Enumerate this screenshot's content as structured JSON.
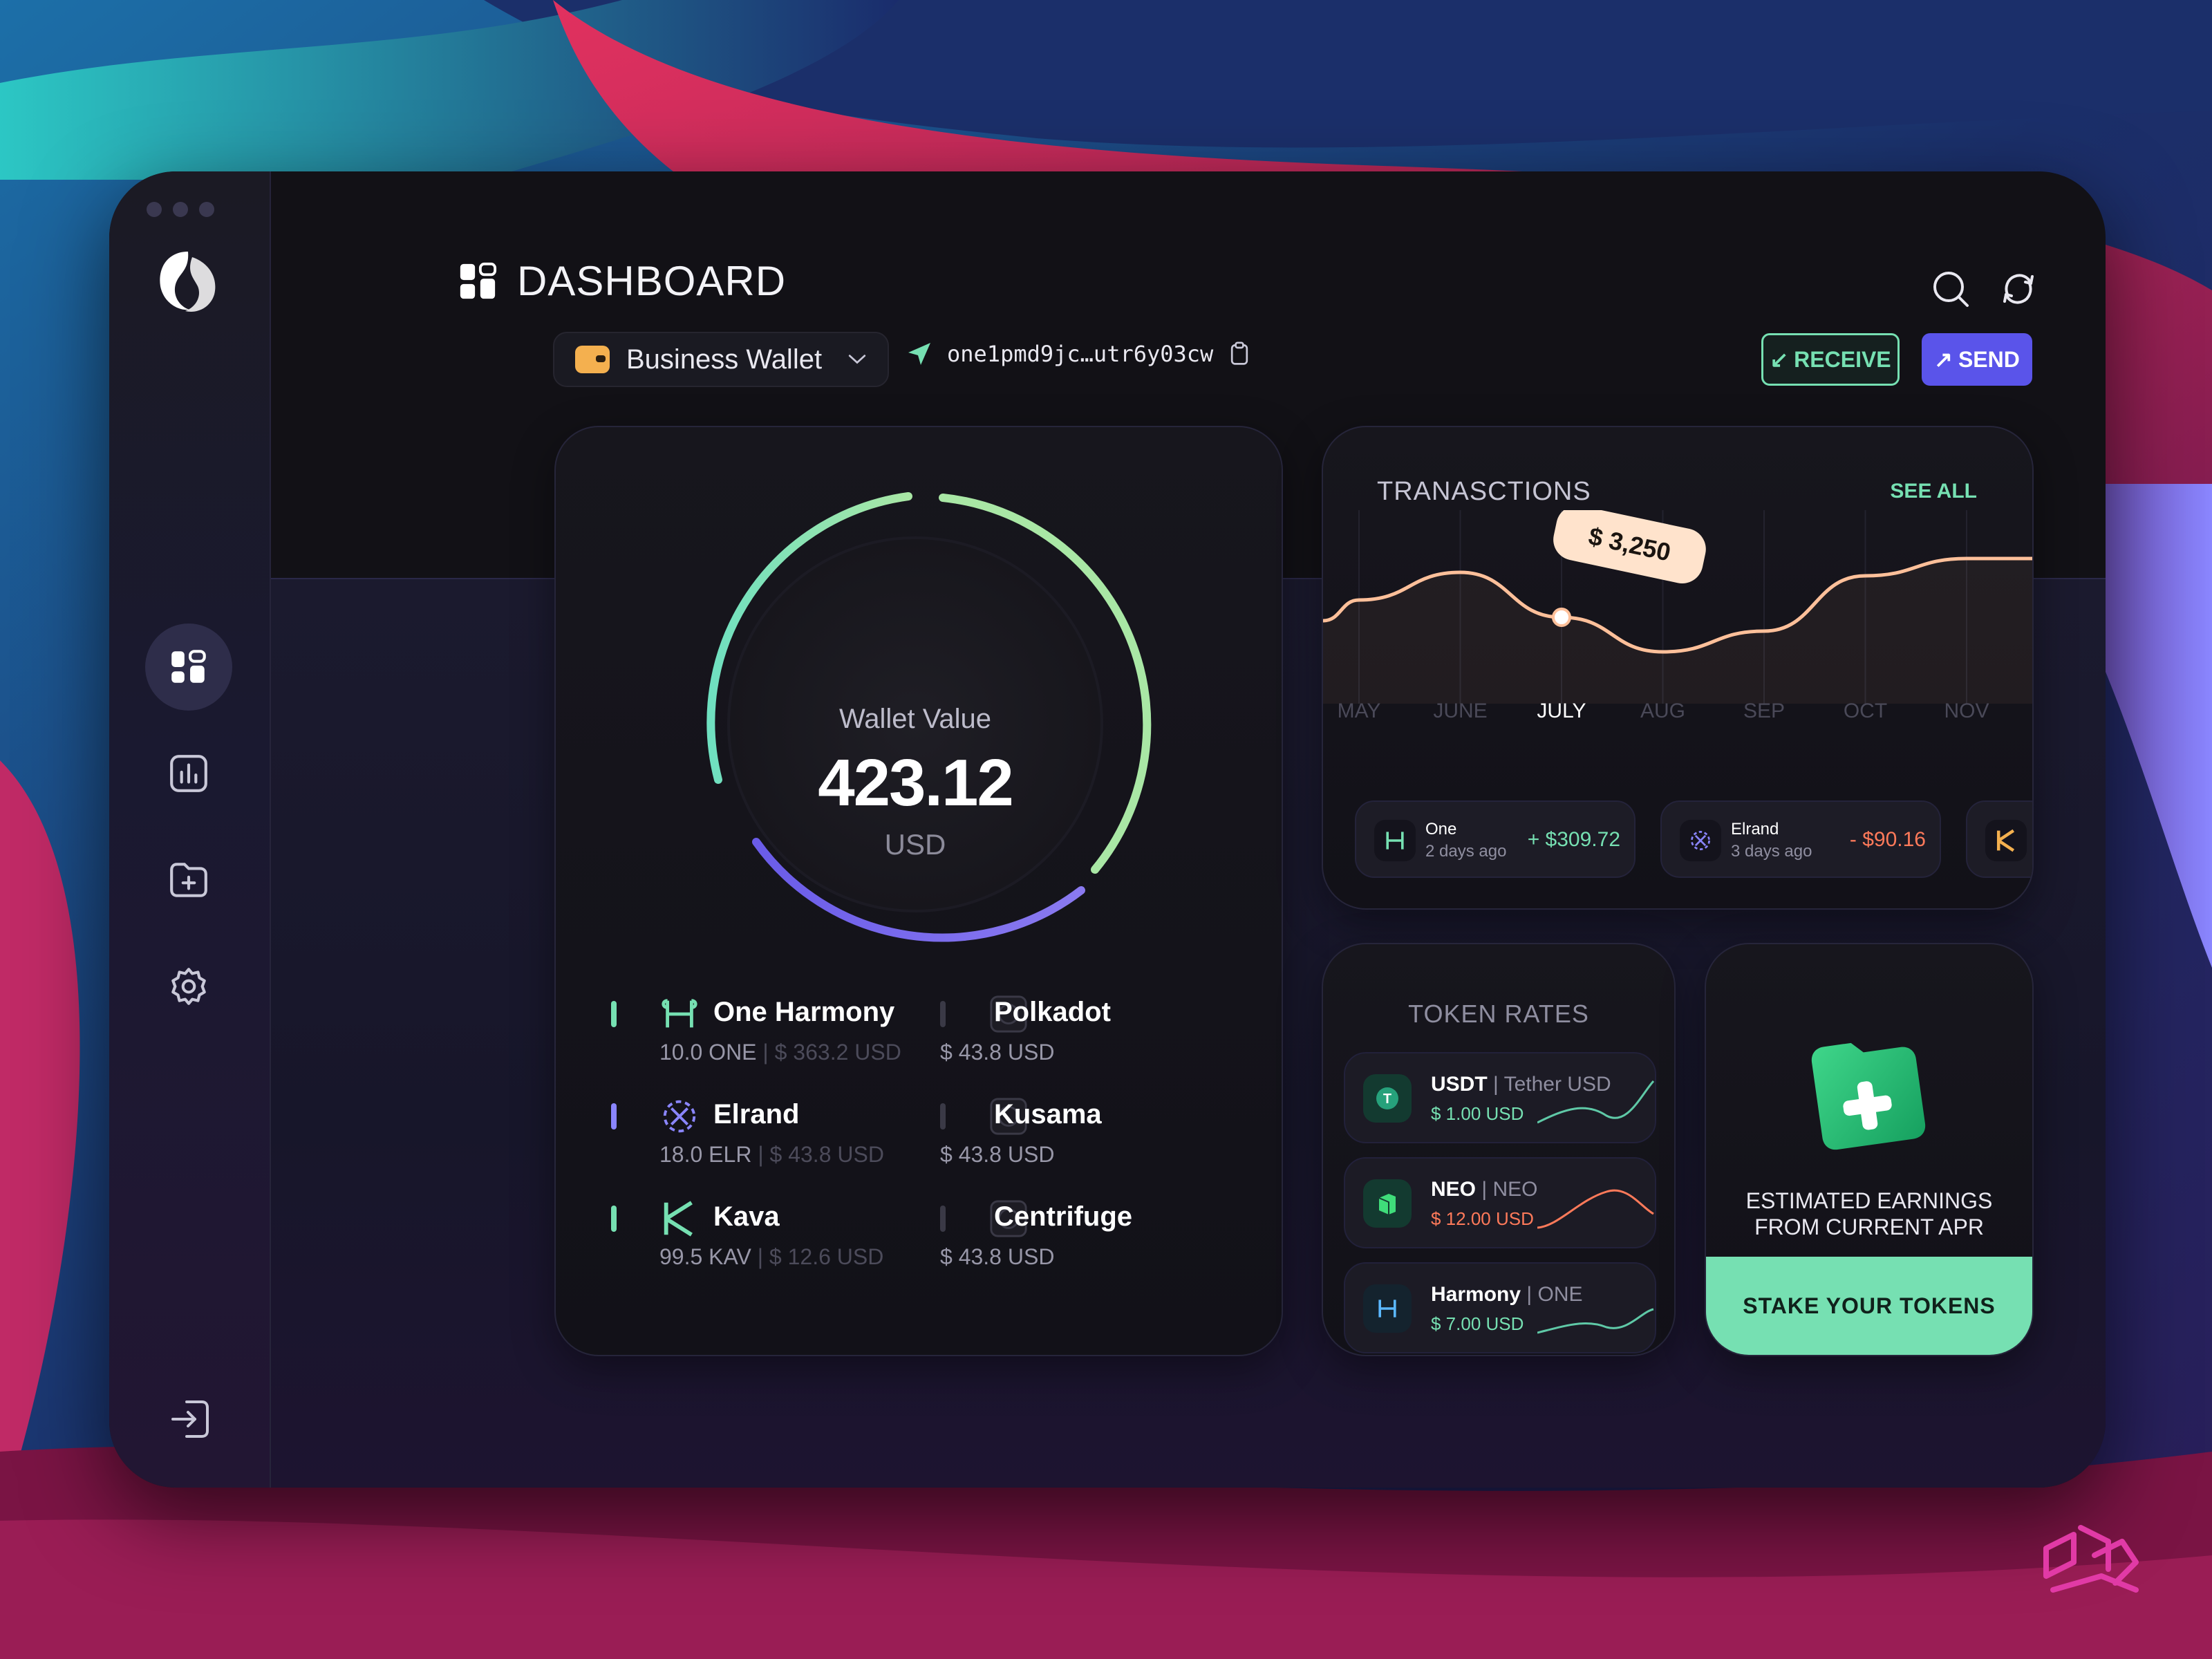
{
  "page": {
    "title": "DASHBOARD",
    "accent_color": "#5a54ea",
    "positive_color": "#76e0b2",
    "negative_color": "#ff7a5a"
  },
  "wallet": {
    "selected": "Business Wallet",
    "address": "one1pmd9jc…utr6y03cw"
  },
  "actions": {
    "receive_label": "RECEIVE",
    "send_label": "SEND"
  },
  "balance": {
    "label": "Wallet Value",
    "value": "423.12",
    "unit": "USD"
  },
  "assets": [
    {
      "name": "One Harmony",
      "amount": "10.0 ONE",
      "usd": "$ 363.2 USD",
      "icon": "harmony-icon",
      "color": "#76e0b2"
    },
    {
      "name": "Polkadot",
      "amount": "$ 43.8 USD",
      "usd": "",
      "icon": "polkadot-icon",
      "color": "#3a3946"
    },
    {
      "name": "Elrand",
      "amount": "18.0 ELR",
      "usd": "$ 43.8 USD",
      "icon": "elrond-icon",
      "color": "#8a85ff"
    },
    {
      "name": "Kusama",
      "amount": "$ 43.8 USD",
      "usd": "",
      "icon": "kusama-icon",
      "color": "#3a3946"
    },
    {
      "name": "Kava",
      "amount": "99.5 KAV",
      "usd": "$ 12.6 USD",
      "icon": "kava-icon",
      "color": "#76e0b2"
    },
    {
      "name": "Centrifuge",
      "amount": "$ 43.8 USD",
      "usd": "",
      "icon": "centrifuge-icon",
      "color": "#3a3946"
    }
  ],
  "transactions": {
    "title": "TRANASCTIONS",
    "see_all": "SEE ALL",
    "tooltip": "$ 3,250",
    "active_month": "JULY",
    "items": [
      {
        "name": "One",
        "time": "2 days ago",
        "amount": "+ $309.72",
        "positive": true
      },
      {
        "name": "Elrand",
        "time": "3 days ago",
        "amount": "- $90.16",
        "positive": false
      }
    ]
  },
  "chart_data": {
    "type": "line",
    "categories": [
      "MAY",
      "JUNE",
      "JULY",
      "AUG",
      "SEP",
      "OCT",
      "NOV"
    ],
    "series": [
      {
        "values": [
          3500,
          3900,
          3250,
          2750,
          3050,
          3850,
          4100
        ]
      }
    ],
    "highlight": {
      "category": "JULY",
      "value": 3250,
      "label": "$ 3,250"
    }
  },
  "token_rates": {
    "title": "TOKEN RATES",
    "items": [
      {
        "symbol": "USDT",
        "name": "Tether USD",
        "price": "$ 1.00 USD",
        "trend": "up"
      },
      {
        "symbol": "NEO",
        "name": "NEO",
        "price": "$ 12.00 USD",
        "trend": "down"
      },
      {
        "symbol": "Harmony",
        "name": "ONE",
        "price": "$ 7.00 USD",
        "trend": "up"
      }
    ]
  },
  "stake": {
    "text_line1": "ESTIMATED EARNINGS",
    "text_line2": "FROM CURRENT APR",
    "button": "STAKE YOUR TOKENS"
  }
}
